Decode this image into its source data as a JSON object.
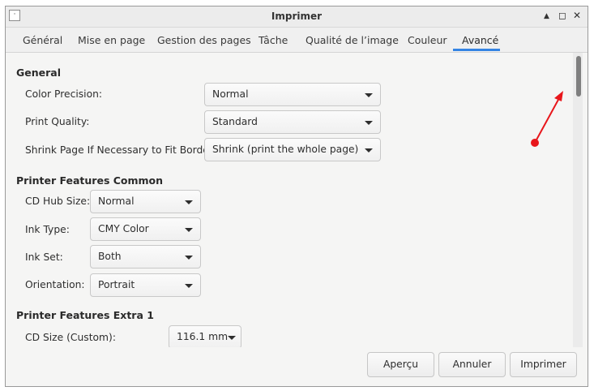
{
  "window": {
    "menu_glyph": "·",
    "title": "Imprimer",
    "controls": {
      "minimize": "▲",
      "maximize": "◻",
      "close": "✕"
    }
  },
  "tabs": [
    {
      "label": "Général"
    },
    {
      "label": "Mise en page"
    },
    {
      "label": "Gestion des pages"
    },
    {
      "label": "Tâche"
    },
    {
      "label": "Qualité de l’image"
    },
    {
      "label": "Couleur"
    },
    {
      "label": "Avancé",
      "active": true
    }
  ],
  "sections": {
    "general": {
      "title": "General",
      "color_precision": {
        "label": "Color Precision:",
        "value": "Normal"
      },
      "print_quality": {
        "label": "Print Quality:",
        "value": "Standard"
      },
      "shrink_page": {
        "label": "Shrink Page If Necessary to Fit Borders:",
        "value": "Shrink (print the whole page)"
      }
    },
    "features_common": {
      "title": "Printer Features Common",
      "cd_hub_size": {
        "label": "CD Hub Size:",
        "value": "Normal"
      },
      "ink_type": {
        "label": "Ink Type:",
        "value": "CMY Color"
      },
      "ink_set": {
        "label": "Ink Set:",
        "value": "Both"
      },
      "orientation": {
        "label": "Orientation:",
        "value": "Portrait"
      }
    },
    "features_extra": {
      "title": "Printer Features Extra 1",
      "cd_size": {
        "label": "CD Size (Custom):",
        "value": "116.1 mm"
      }
    }
  },
  "buttons": {
    "preview": "Aperçu",
    "cancel": "Annuler",
    "print": "Imprimer"
  },
  "colors": {
    "accent": "#3584e4",
    "annotation": "#e8161b"
  }
}
